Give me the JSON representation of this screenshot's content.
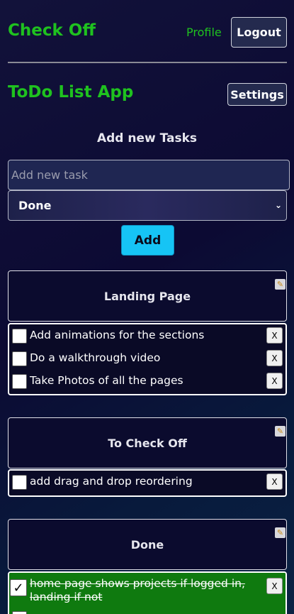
{
  "header": {
    "app_title": "Check Off",
    "profile_label": "Profile",
    "logout_label": "Logout"
  },
  "page": {
    "title": "ToDo List App",
    "settings_label": "Settings"
  },
  "add_task": {
    "heading": "Add new Tasks",
    "input_placeholder": "Add new task",
    "input_value": "",
    "selected_project": "Done",
    "add_label": "Add"
  },
  "projects": [
    {
      "title": "Landing Page",
      "tasks": [
        {
          "text": "Add animations for the sections",
          "done": false,
          "delete_label": "X"
        },
        {
          "text": "Do a walkthrough video",
          "done": false,
          "delete_label": "X"
        },
        {
          "text": "Take Photos of all the pages",
          "done": false,
          "delete_label": "X"
        }
      ]
    },
    {
      "title": "To Check Off",
      "tasks": [
        {
          "text": "add drag and drop reordering",
          "done": false,
          "delete_label": "X"
        }
      ]
    },
    {
      "title": "Done",
      "tasks": [
        {
          "text": "home page shows projects if logged in, landing if not",
          "done": true,
          "delete_label": "X"
        }
      ]
    }
  ],
  "icons": {
    "edit": "edit-icon",
    "select_chevron": "chevron-down-icon",
    "check": "checkmark-icon"
  },
  "colors": {
    "brand_green": "#1fc21f",
    "add_button": "#16c4f5",
    "done_row": "#0f7a0f"
  }
}
